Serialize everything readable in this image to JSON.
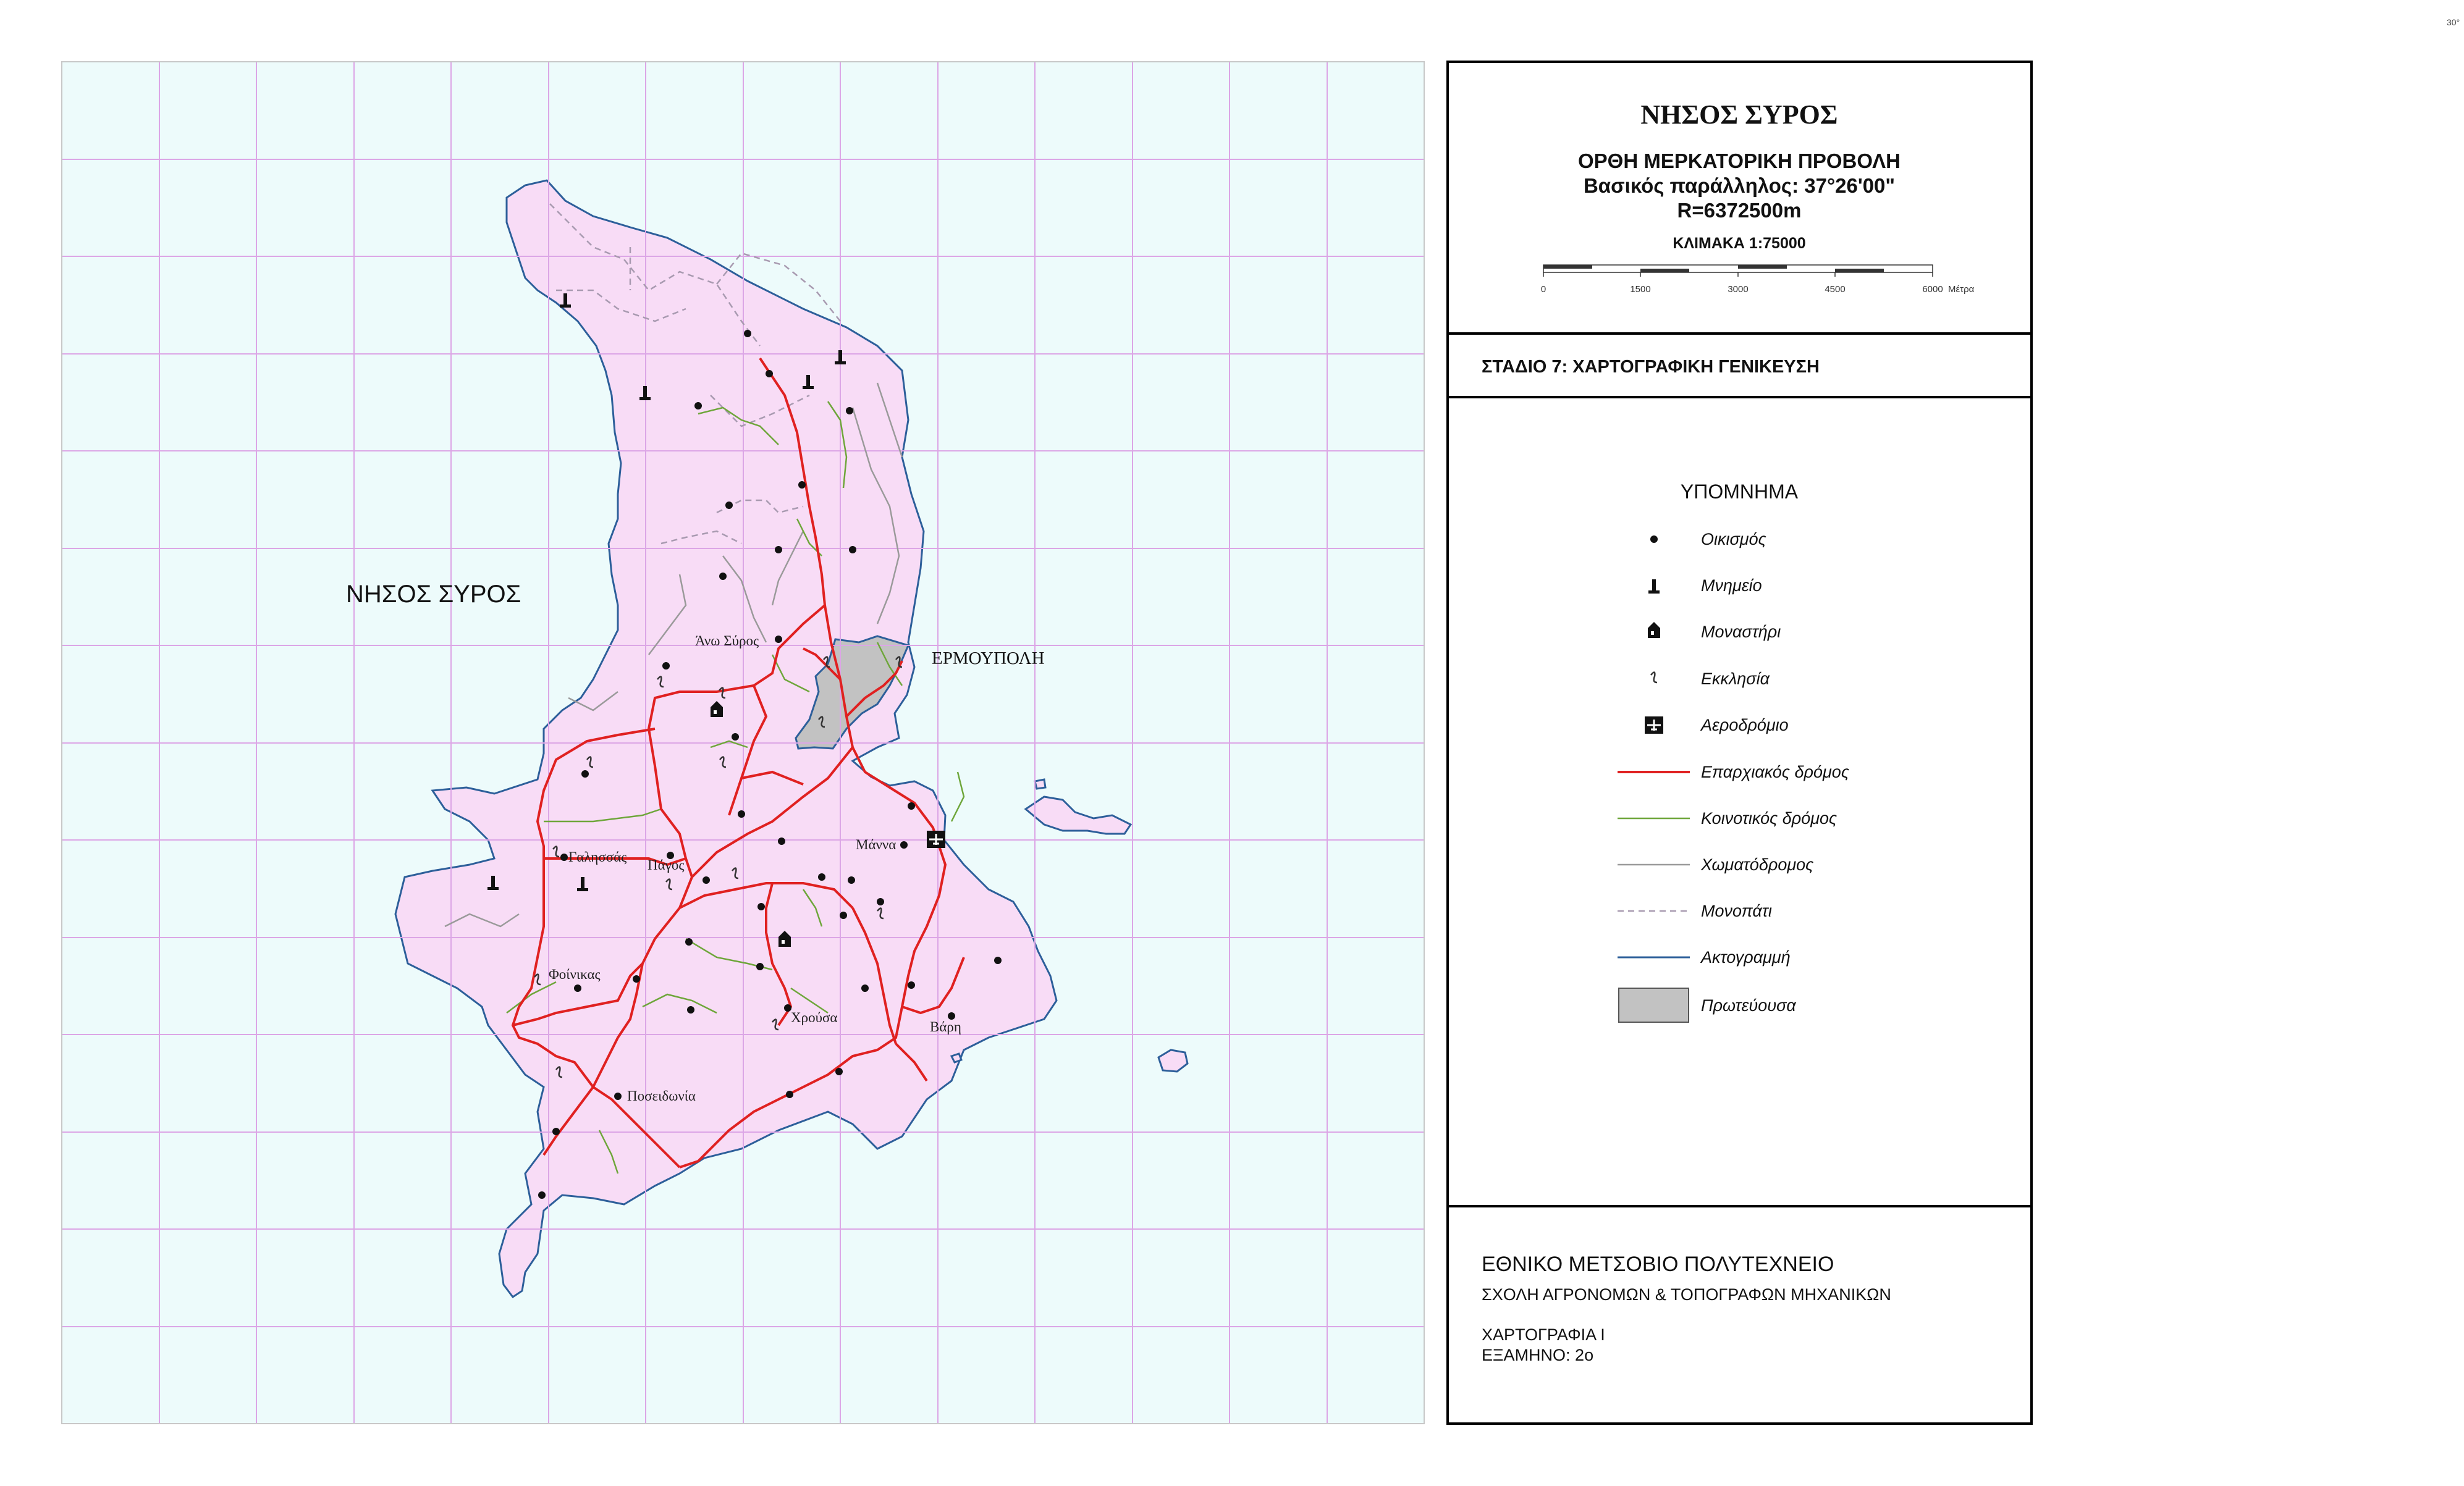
{
  "corner_mark": "30°",
  "map": {
    "island_label": "ΝΗΣΟΣ ΣΥΡΟΣ",
    "capital_label": "ΕΡΜΟΥΠΟΛΗ",
    "places": [
      {
        "name": "Άνω Σύρος"
      },
      {
        "name": "Γαλησσάς"
      },
      {
        "name": "Πάγος"
      },
      {
        "name": "Μάννα"
      },
      {
        "name": "Φοίνικας"
      },
      {
        "name": "Χρούσα"
      },
      {
        "name": "Βάρη"
      },
      {
        "name": "Ποσειδωνία"
      }
    ],
    "colors": {
      "sea": "#edfbfb",
      "land": "#f8dcf6",
      "grid": "#dca6e6",
      "coast": "#2d5f9a",
      "provincial_road": "#e02121",
      "community_road": "#6ea63a",
      "dirt_road": "#9a9a9a",
      "path": "#a89ab0",
      "capital": "#c2c2c2"
    }
  },
  "panel": {
    "title": "ΝΗΣΟΣ ΣΥΡΟΣ",
    "projection": "ΟΡΘΗ ΜΕΡΚΑΤΟΡΙΚΗ ΠΡΟΒΟΛΗ",
    "parallel": "Βασικός παράλληλος: 37°26'00\"",
    "radius": "R=6372500m",
    "scale_label": "ΚΛΙΜΑΚΑ 1:75000",
    "scale_ticks": [
      "0",
      "1500",
      "3000",
      "4500",
      "6000"
    ],
    "scale_unit": "Μέτρα",
    "stage": "ΣΤΑΔΙΟ 7: ΧΑΡΤΟΓΡΑΦΙΚΗ ΓΕΝΙΚΕΥΣΗ",
    "legend_title": "ΥΠΟΜΝΗΜΑ",
    "legend": [
      {
        "label": "Οικισμός",
        "icon": "settlement-dot-icon"
      },
      {
        "label": "Μνημείο",
        "icon": "monument-icon"
      },
      {
        "label": "Μοναστήρι",
        "icon": "monastery-icon"
      },
      {
        "label": "Εκκλησία",
        "icon": "church-icon"
      },
      {
        "label": "Αεροδρόμιο",
        "icon": "airport-icon"
      },
      {
        "label": "Επαρχιακός δρόμος",
        "icon": "provincial-road-line-icon"
      },
      {
        "label": "Κοινοτικός δρόμος",
        "icon": "community-road-line-icon"
      },
      {
        "label": "Χωματόδρομος",
        "icon": "dirt-road-line-icon"
      },
      {
        "label": "Μονοπάτι",
        "icon": "path-dashed-line-icon"
      },
      {
        "label": "Ακτογραμμή",
        "icon": "coastline-line-icon"
      },
      {
        "label": "Πρωτεύουσα",
        "icon": "capital-area-icon"
      }
    ],
    "institution": "ΕΘΝΙΚΟ ΜΕΤΣΟΒΙΟ ΠΟΛΥΤΕΧΝΕΙΟ",
    "school": "ΣΧΟΛΗ ΑΓΡΟΝΟΜΩΝ & ΤΟΠΟΓΡΑΦΩΝ ΜΗΧΑΝΙΚΩΝ",
    "course": "ΧΑΡΤΟΓΡΑΦΙΑ Ι",
    "semester": "ΕΞΑΜΗΝΟ: 2ο"
  }
}
